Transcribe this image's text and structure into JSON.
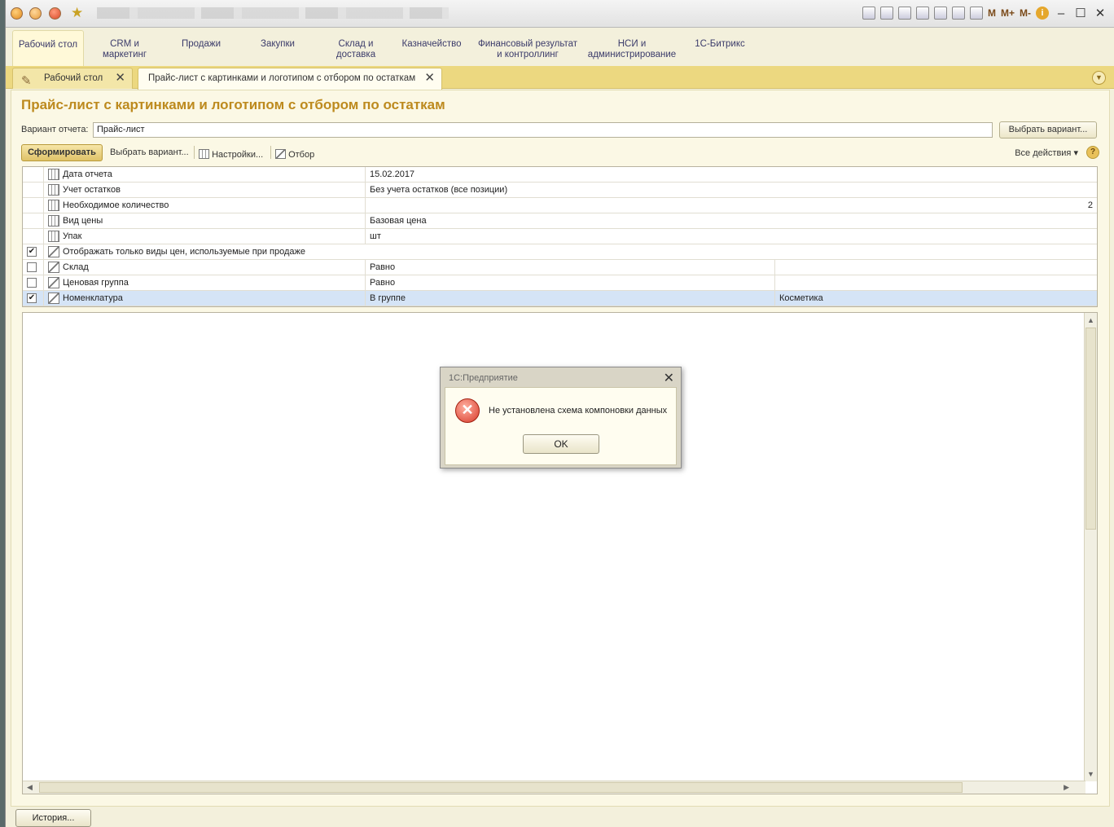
{
  "titlebar": {
    "toolbar_m": "M",
    "toolbar_mplus": "M+",
    "toolbar_mminus": "M-"
  },
  "menu": [
    {
      "label": "Рабочий стол"
    },
    {
      "label": "CRM и маркетинг"
    },
    {
      "label": "Продажи"
    },
    {
      "label": "Закупки"
    },
    {
      "label": "Склад и доставка"
    },
    {
      "label": "Казначейство"
    },
    {
      "label": "Финансовый результат и контроллинг"
    },
    {
      "label": "НСИ и администрирование"
    },
    {
      "label": "1С-Битрикс"
    }
  ],
  "tabs": [
    {
      "label": "Рабочий стол"
    },
    {
      "label": "Прайс-лист с картинками и логотипом с отбором по остаткам"
    }
  ],
  "page": {
    "title": "Прайс-лист с картинками и логотипом с отбором по остаткам",
    "variant_label": "Вариант отчета:",
    "variant_value": "Прайс-лист",
    "choose_variant_top": "Выбрать вариант...",
    "generate": "Сформировать",
    "choose_variant": "Выбрать вариант...",
    "settings": "Настройки...",
    "filter": "Отбор",
    "all_actions": "Все действия",
    "help": "?"
  },
  "settings_rows": [
    {
      "name": "Дата отчета",
      "value": "15.02.2017"
    },
    {
      "name": "Учет остатков",
      "value": "Без учета остатков (все позиции)"
    },
    {
      "name": "Необходимое количество",
      "value": "",
      "number": "2"
    },
    {
      "name": "Вид цены",
      "value": "Базовая цена"
    },
    {
      "name": "Упак",
      "value": "шт"
    },
    {
      "name": "Отображать только виды цен, используемые при продаже",
      "checked": true
    },
    {
      "name": "Склад",
      "value": "Равно",
      "value2": "",
      "checked": false
    },
    {
      "name": "Ценовая группа",
      "value": "Равно",
      "value2": "",
      "checked": false
    },
    {
      "name": "Номенклатура",
      "value": "В группе",
      "value2": "Косметика",
      "checked": true
    }
  ],
  "dialog": {
    "title": "1С:Предприятие",
    "message": "Не установлена схема компоновки данных",
    "ok": "OK"
  },
  "footer": {
    "history": "История..."
  }
}
